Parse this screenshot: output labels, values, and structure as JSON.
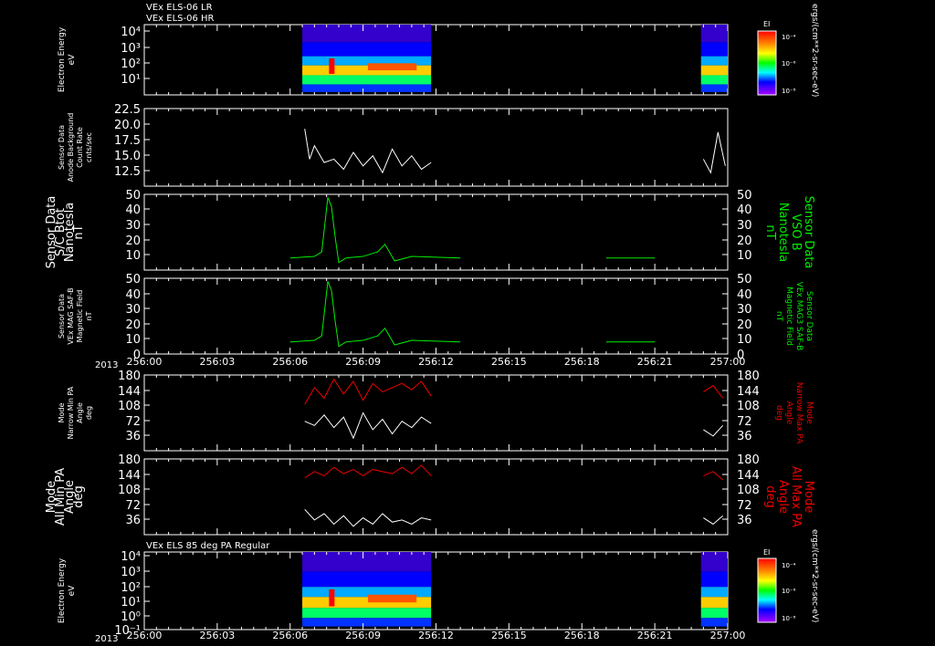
{
  "colors": {
    "background": "#000000",
    "axis": "#ffffff",
    "trace_white": "#ffffff",
    "trace_green": "#00ee00",
    "trace_red": "#ee0000"
  },
  "titles": {
    "top1": "VEx ELS-06 LR",
    "top2": "VEx ELS-06 HR",
    "bottom1": "VEx ELS 85 deg PA Regular"
  },
  "time_axis": {
    "year_label": "2013",
    "tick_labels": [
      "256:00",
      "256:03",
      "256:06",
      "256:09",
      "256:12",
      "256:15",
      "256:18",
      "256:21",
      "257:00"
    ]
  },
  "colorbar": {
    "label": "EI",
    "unit": "ergs/(cm**2-sr-sec-eV)",
    "ticks": [
      "10⁻⁴",
      "10⁻⁶",
      "10⁻⁸"
    ]
  },
  "panels": {
    "p1": {
      "ylabel": [
        "Electron Energy",
        "eV"
      ],
      "ticks": [
        "10⁴",
        "10³",
        "10²",
        "10¹"
      ]
    },
    "p2": {
      "ylabel": [
        "Sensor Data",
        "Anode Background",
        "Count Rate",
        "cnts/sec"
      ],
      "ticks": [
        "22.5",
        "20.0",
        "17.5",
        "15.0",
        "12.5"
      ]
    },
    "p3": {
      "ylabel": [
        "Sensor Data",
        "S/C Btot",
        "Nanotesla",
        "nT"
      ],
      "ylabel_right": [
        "Sensor Data",
        "VSO B",
        "Nanotesla",
        "nT"
      ],
      "ticks": [
        "50",
        "40",
        "30",
        "20",
        "10"
      ]
    },
    "p4": {
      "ylabel": [
        "Sensor Data",
        "VEx MAG SAF-B",
        "Magnetic Field",
        "nT"
      ],
      "ylabel_right": [
        "Sensor Data",
        "VEx MAG3 SAF-B",
        "Magnetic Field",
        "nT"
      ],
      "ticks": [
        "50",
        "40",
        "30",
        "20",
        "10",
        "0"
      ]
    },
    "p5": {
      "ylabel": [
        "Mode",
        "Narrow Min PA",
        "Angle",
        "deg"
      ],
      "ylabel_right": [
        "Mode",
        "Narrow Max PA",
        "Angle",
        "deg"
      ],
      "ticks": [
        "180",
        "144",
        "108",
        "72",
        "36"
      ]
    },
    "p6": {
      "ylabel": [
        "Mode",
        "All Min PA",
        "Angle",
        "deg"
      ],
      "ylabel_right": [
        "Mode",
        "All Max PA",
        "Angle",
        "deg"
      ],
      "ticks": [
        "180",
        "144",
        "108",
        "72",
        "36"
      ]
    },
    "p7": {
      "ylabel": [
        "Electron Energy",
        "eV"
      ],
      "ticks": [
        "10⁴",
        "10³",
        "10²",
        "10¹",
        "10⁰",
        "10⁻¹"
      ]
    }
  },
  "chart_data": [
    {
      "type": "heatmap",
      "title": "VEx ELS-06 LR / VEx ELS-06 HR",
      "ylabel": "Electron Energy eV",
      "y_scale": "log",
      "x_range": [
        "256:00",
        "257:00"
      ],
      "data_intervals": [
        [
          "256:06.5",
          "256:11.8"
        ],
        [
          "256:22.9",
          "257:00"
        ]
      ]
    },
    {
      "type": "line",
      "ylabel": "Sensor Data Anode Background Count Rate cnts/sec",
      "ylim": [
        11,
        22.5
      ],
      "series": [
        {
          "x_minutes": [
            6.6,
            6.8,
            7.0,
            7.4,
            7.8,
            8.2,
            8.6,
            9.0,
            9.4,
            9.8,
            10.2,
            10.6,
            11.0,
            11.4,
            11.8,
            23.0,
            23.3,
            23.6,
            23.9
          ],
          "values": [
            19.5,
            15.0,
            17.0,
            14.5,
            15.0,
            13.5,
            16.0,
            14.0,
            15.5,
            13.0,
            16.5,
            14.0,
            15.5,
            13.5,
            14.5,
            15.0,
            13.0,
            19.0,
            14.0
          ]
        }
      ]
    },
    {
      "type": "line",
      "ylabel": "Sensor Data S/C Btot Nanotesla nT",
      "ylim": [
        0,
        50
      ],
      "series": [
        {
          "x_minutes": [
            0,
            3,
            6,
            7.0,
            7.3,
            7.55,
            7.7,
            7.85,
            8.0,
            8.3,
            9.0,
            9.6,
            9.9,
            10.3,
            11,
            13,
            16,
            19,
            21,
            24
          ],
          "values": [
            8,
            9,
            8,
            9,
            12,
            48,
            42,
            22,
            5,
            8,
            9,
            12,
            17,
            6,
            9,
            8,
            9,
            8,
            8,
            9
          ]
        }
      ]
    },
    {
      "type": "line",
      "ylabel": "Sensor Data VEx MAG SAF-B Magnetic Field nT",
      "ylim": [
        0,
        50
      ],
      "series": [
        {
          "x_minutes": [
            0,
            3,
            6,
            7.0,
            7.3,
            7.55,
            7.7,
            7.85,
            8.0,
            8.3,
            9.0,
            9.6,
            9.9,
            10.3,
            11,
            13,
            16,
            19,
            21,
            24
          ],
          "values": [
            8,
            9,
            8,
            9,
            12,
            48,
            42,
            22,
            5,
            8,
            9,
            12,
            17,
            6,
            9,
            8,
            9,
            8,
            8,
            9
          ]
        }
      ]
    },
    {
      "type": "line",
      "ylabel": "Mode Narrow Min PA Angle deg",
      "ylim": [
        0,
        180
      ],
      "series": [
        {
          "name": "Narrow Min PA",
          "x_minutes": [
            6.6,
            7.0,
            7.4,
            7.8,
            8.2,
            8.6,
            9.0,
            9.4,
            9.8,
            10.2,
            10.6,
            11.0,
            11.4,
            11.8,
            23.0,
            23.4,
            23.8
          ],
          "values": [
            70,
            60,
            85,
            55,
            80,
            30,
            90,
            50,
            75,
            40,
            70,
            55,
            80,
            65,
            50,
            35,
            60
          ]
        },
        {
          "name": "Narrow Max PA",
          "x_minutes": [
            6.6,
            7.0,
            7.4,
            7.8,
            8.2,
            8.6,
            9.0,
            9.4,
            9.8,
            10.2,
            10.6,
            11.0,
            11.4,
            11.8,
            23.0,
            23.4,
            23.8
          ],
          "values": [
            110,
            150,
            125,
            170,
            135,
            165,
            120,
            160,
            140,
            150,
            160,
            145,
            165,
            130,
            140,
            155,
            125
          ]
        }
      ]
    },
    {
      "type": "line",
      "ylabel": "Mode All Min PA Angle deg",
      "ylim": [
        0,
        180
      ],
      "series": [
        {
          "name": "All Min PA",
          "x_minutes": [
            6.6,
            7.0,
            7.4,
            7.8,
            8.2,
            8.6,
            9.0,
            9.4,
            9.8,
            10.2,
            10.6,
            11.0,
            11.4,
            11.8,
            23.0,
            23.4,
            23.8
          ],
          "values": [
            60,
            35,
            50,
            25,
            45,
            20,
            40,
            25,
            50,
            30,
            35,
            25,
            40,
            35,
            40,
            25,
            45
          ]
        },
        {
          "name": "All Max PA",
          "x_minutes": [
            6.6,
            7.0,
            7.4,
            7.8,
            8.2,
            8.6,
            9.0,
            9.4,
            9.8,
            10.2,
            10.6,
            11.0,
            11.4,
            11.8,
            23.0,
            23.4,
            23.8
          ],
          "values": [
            135,
            150,
            140,
            160,
            145,
            155,
            140,
            155,
            150,
            145,
            160,
            145,
            165,
            140,
            140,
            150,
            130
          ]
        }
      ]
    },
    {
      "type": "heatmap",
      "title": "VEx ELS 85 deg PA Regular",
      "ylabel": "Electron Energy eV",
      "y_scale": "log",
      "x_range": [
        "256:00",
        "257:00"
      ],
      "data_intervals": [
        [
          "256:06.5",
          "256:11.8"
        ],
        [
          "256:22.9",
          "257:00"
        ]
      ]
    }
  ]
}
